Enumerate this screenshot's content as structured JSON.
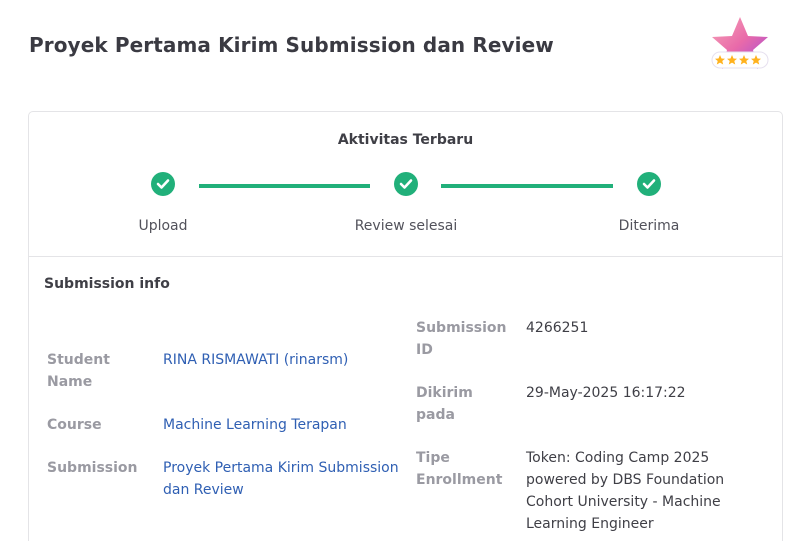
{
  "page": {
    "title": "Proyek Pertama Kirim Submission dan Review",
    "badge_icon": "star-rating-badge-icon",
    "badge_stars": 4
  },
  "activity": {
    "title": "Aktivitas Terbaru",
    "accent_color": "#21b07a",
    "steps": [
      {
        "label": "Upload",
        "status": "done"
      },
      {
        "label": "Review selesai",
        "status": "done"
      },
      {
        "label": "Diterima",
        "status": "done"
      }
    ]
  },
  "submission_info": {
    "heading": "Submission info",
    "student_name_label": "Student Name",
    "student_name_value": "RINA RISMAWATI (rinarsm)",
    "course_label": "Course",
    "course_value": "Machine Learning Terapan",
    "submission_label": "Submission",
    "submission_value": "Proyek Pertama Kirim Submission dan Review",
    "submission_id_label": "Submission ID",
    "submission_id_value": "4266251",
    "sent_label": "Dikirim pada",
    "sent_value": "29-May-2025 16:17:22",
    "enrollment_label": "Tipe Enrollment",
    "enrollment_value": "Token: Coding Camp 2025 powered by DBS Foundation Cohort University - Machine Learning Engineer",
    "link_color": "#2f5fb3"
  }
}
